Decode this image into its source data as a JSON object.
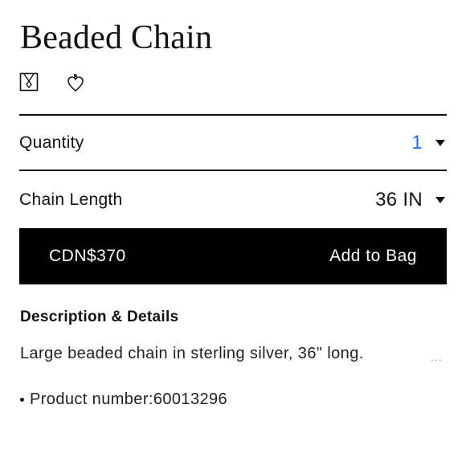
{
  "product": {
    "title": "Beaded Chain"
  },
  "icons": [
    "necklace-box-icon",
    "heart-pendant-icon"
  ],
  "quantity": {
    "label": "Quantity",
    "value": "1"
  },
  "chain_length": {
    "label": "Chain Length",
    "value": "36 IN"
  },
  "add_to_bag": {
    "price": "CDN$370",
    "label": "Add to Bag"
  },
  "description": {
    "heading": "Description & Details",
    "text": "Large beaded chain in sterling silver, 36\" long.",
    "more": "...",
    "bullets": [
      "Product number:60013296"
    ]
  },
  "colors": {
    "accent": "#1a73e8",
    "button_bg": "#000000",
    "text": "#111111"
  }
}
